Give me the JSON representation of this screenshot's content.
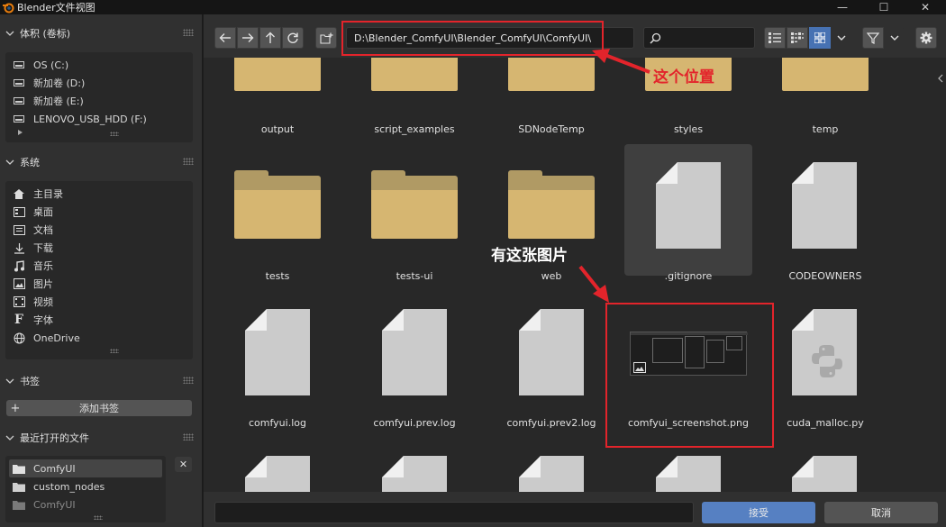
{
  "window": {
    "title": "Blender文件视图",
    "minimize_icon": "—",
    "maximize_icon": "☐",
    "close_icon": "✕"
  },
  "sidebar": {
    "volumes": {
      "header": "体积 (卷标)",
      "items": [
        {
          "label": "OS (C:)",
          "icon": "drive-icon"
        },
        {
          "label": "新加卷 (D:)",
          "icon": "drive-icon"
        },
        {
          "label": "新加卷 (E:)",
          "icon": "drive-icon"
        },
        {
          "label": "LENOVO_USB_HDD (F:)",
          "icon": "drive-icon"
        }
      ]
    },
    "system": {
      "header": "系统",
      "items": [
        {
          "label": "主目录",
          "icon": "home-icon"
        },
        {
          "label": "桌面",
          "icon": "desktop-icon"
        },
        {
          "label": "文档",
          "icon": "document-icon"
        },
        {
          "label": "下载",
          "icon": "download-icon"
        },
        {
          "label": "音乐",
          "icon": "music-icon"
        },
        {
          "label": "图片",
          "icon": "image-icon"
        },
        {
          "label": "视频",
          "icon": "video-icon"
        },
        {
          "label": "字体",
          "icon": "font-icon"
        },
        {
          "label": "OneDrive",
          "icon": "globe-icon"
        }
      ]
    },
    "bookmarks": {
      "header": "书签",
      "add_label": "添加书签",
      "add_icon": "+"
    },
    "recent": {
      "header": "最近打开的文件",
      "items": [
        {
          "label": "ComfyUI",
          "icon": "folder-icon"
        },
        {
          "label": "custom_nodes",
          "icon": "folder-icon"
        },
        {
          "label": "ComfyUI",
          "icon": "folder-icon"
        }
      ],
      "clear_icon": "✕"
    }
  },
  "toolbar": {
    "path": "D:\\Blender_ComfyUI\\Blender_ComfyUI\\ComfyUI\\",
    "search_value": ""
  },
  "annotations": {
    "path_note": "这个位置",
    "image_note": "有这张图片"
  },
  "files": {
    "row1": [
      "output",
      "script_examples",
      "SDNodeTemp",
      "styles",
      "temp"
    ],
    "row2": [
      {
        "name": "tests",
        "kind": "folder"
      },
      {
        "name": "tests-ui",
        "kind": "folder"
      },
      {
        "name": "web",
        "kind": "folder"
      },
      {
        "name": ".gitignore",
        "kind": "file"
      },
      {
        "name": "CODEOWNERS",
        "kind": "file"
      }
    ],
    "row3": [
      {
        "name": "comfyui.log",
        "kind": "file"
      },
      {
        "name": "comfyui.prev.log",
        "kind": "file"
      },
      {
        "name": "comfyui.prev2.log",
        "kind": "file"
      },
      {
        "name": "comfyui_screenshot.png",
        "kind": "image"
      },
      {
        "name": "cuda_malloc.py",
        "kind": "python"
      }
    ]
  },
  "footer": {
    "filename_value": "",
    "accept_label": "接受",
    "cancel_label": "取消"
  },
  "colors": {
    "accent_red": "#e3242b",
    "accept_blue": "#5680c2",
    "folder": "#d6b671"
  }
}
